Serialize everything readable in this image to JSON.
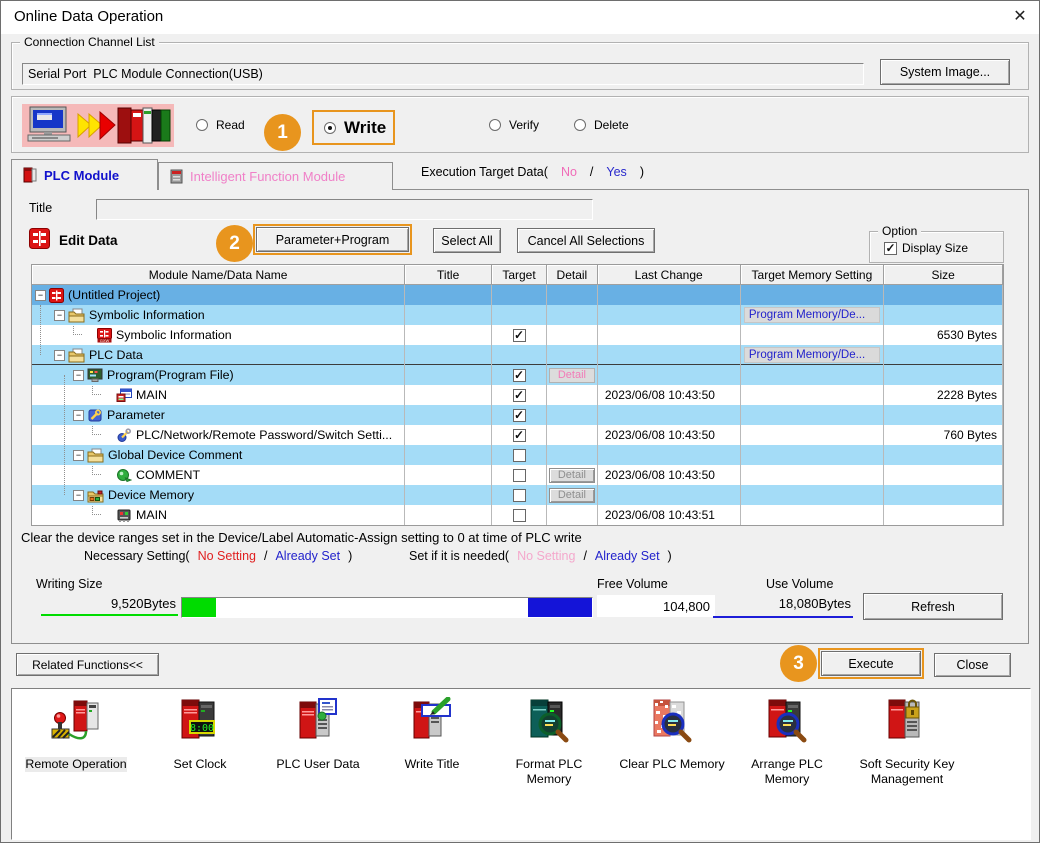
{
  "window": {
    "title": "Online Data Operation",
    "close_glyph": "✕"
  },
  "colors": {
    "accent_orange": "#e8951e",
    "row_module_blue": "#68b0e4",
    "row_category_blue": "#a4dcf7",
    "link_blue": "#2222cc",
    "alert_red": "#e02020",
    "pink": "#f06cb8",
    "light_pink": "#f4a8cc",
    "green_bar": "#00dc00",
    "blue_bar": "#1414d8"
  },
  "connection": {
    "group_label": "Connection Channel List",
    "channel": "Serial Port  PLC Module Connection(USB)",
    "system_image_button": "System Image..."
  },
  "operation": {
    "read": "Read",
    "write": "Write",
    "verify": "Verify",
    "delete": "Delete",
    "selected": "Write",
    "step1": "1"
  },
  "tabs": {
    "plc_module": "PLC Module",
    "intelligent": "Intelligent Function Module",
    "execution_prefix": "Execution Target Data(",
    "no": "No",
    "slash": "/",
    "yes": "Yes",
    "close_paren": ")"
  },
  "title_field": {
    "label": "Title",
    "value": ""
  },
  "edit": {
    "label": "Edit Data",
    "step2": "2",
    "parameter_program_button": "Parameter+Program",
    "select_all_button": "Select All",
    "cancel_all_button": "Cancel All Selections",
    "option_label": "Option",
    "display_size_label": "Display Size",
    "display_size_checked": true
  },
  "table": {
    "headers": [
      "Module Name/Data Name",
      "Title",
      "Target",
      "Detail",
      "Last Change",
      "Target Memory Setting",
      "Size"
    ],
    "rows": [
      {
        "name": "(Untitled Project)",
        "level": 0,
        "style": "module",
        "icon": "project",
        "expand": "-"
      },
      {
        "name": "Symbolic Information",
        "level": 1,
        "style": "category",
        "icon": "folder",
        "expand": "-",
        "memory": "Program Memory/De..."
      },
      {
        "name": "Symbolic Information",
        "level": 2,
        "style": "leaf",
        "icon": "gxfile",
        "checked": true,
        "size": "6530 Bytes"
      },
      {
        "name": "PLC Data",
        "level": 1,
        "style": "category",
        "icon": "folder",
        "expand": "-",
        "memory": "Program Memory/De...",
        "thick": true
      },
      {
        "name": "Program(Program File)",
        "level": 2,
        "style": "category",
        "icon": "program",
        "expand": "-",
        "checked": true,
        "detail": "enabled"
      },
      {
        "name": "MAIN",
        "level": 3,
        "style": "leaf",
        "icon": "mainprog",
        "checked": true,
        "last_change": "2023/06/08 10:43:50",
        "size": "2228 Bytes"
      },
      {
        "name": "Parameter",
        "level": 2,
        "style": "category",
        "icon": "parameter",
        "expand": "-",
        "checked": true
      },
      {
        "name": "PLC/Network/Remote Password/Switch Setti...",
        "level": 3,
        "style": "leaf",
        "icon": "paramfile",
        "checked": true,
        "last_change": "2023/06/08 10:43:50",
        "size": "760 Bytes"
      },
      {
        "name": "Global Device Comment",
        "level": 2,
        "style": "category",
        "icon": "folder",
        "expand": "-",
        "checked": false
      },
      {
        "name": "COMMENT",
        "level": 3,
        "style": "leaf",
        "icon": "comment",
        "checked": false,
        "detail": "disabled",
        "last_change": "2023/06/08 10:43:50"
      },
      {
        "name": "Device Memory",
        "level": 2,
        "style": "category",
        "icon": "devfolder",
        "expand": "-",
        "checked": false,
        "detail": "disabled"
      },
      {
        "name": "MAIN",
        "level": 3,
        "style": "leaf",
        "icon": "devmain",
        "checked": false,
        "last_change": "2023/06/08 10:43:51"
      }
    ]
  },
  "notes": {
    "clear_note": "Clear the device ranges set in the Device/Label Automatic-Assign setting to 0 at time of PLC write",
    "necessary_prefix": "Necessary Setting(",
    "necessary_no": "No Setting",
    "slash": "/",
    "necessary_already": "Already Set",
    "paren_close": ")",
    "setif_prefix": "Set if it is needed(",
    "setif_no": "No Setting",
    "setif_already": "Already Set"
  },
  "volumes": {
    "writing_size_label": "Writing Size",
    "writing_size_value": "9,520Bytes",
    "free_volume_label": "Free Volume",
    "free_volume_value": "104,800",
    "use_volume_label": "Use Volume",
    "use_volume_value": "18,080Bytes",
    "refresh_button": "Refresh"
  },
  "footer": {
    "related_functions_button": "Related Functions<<",
    "step3": "3",
    "execute_button": "Execute",
    "close_button": "Close"
  },
  "related": {
    "items": [
      {
        "label": "Remote Operation",
        "icon": "remote",
        "highlight": true
      },
      {
        "label": "Set Clock",
        "icon": "clock"
      },
      {
        "label": "PLC User Data",
        "icon": "userdata"
      },
      {
        "label": "Write Title",
        "icon": "writetitle"
      },
      {
        "label": "Format PLC\nMemory",
        "icon": "format"
      },
      {
        "label": "Clear PLC Memory",
        "icon": "clear"
      },
      {
        "label": "Arrange PLC\nMemory",
        "icon": "arrange"
      },
      {
        "label": "Soft Security Key\nManagement",
        "icon": "softkey"
      }
    ]
  }
}
